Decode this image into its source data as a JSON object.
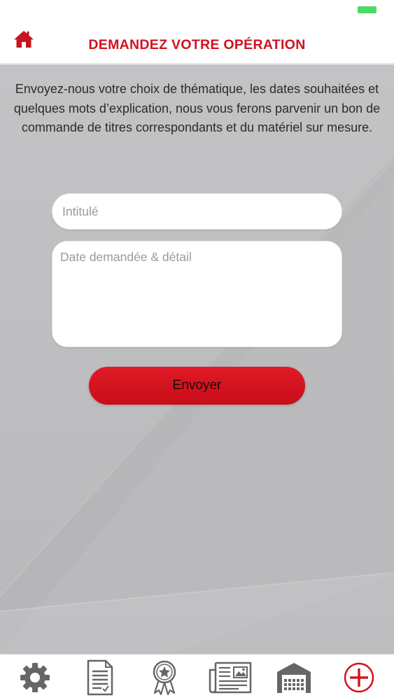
{
  "header": {
    "title": "DEMANDEZ VOTRE OPÉRATION",
    "home_icon": "home-icon"
  },
  "intro": {
    "text": "Envoyez-nous votre choix de thématique, les dates souhaitées et quelques mots d’explication, nous vous ferons parvenir un bon de commande de titres correspondants et du matériel sur mesure."
  },
  "form": {
    "title_placeholder": "Intitulé",
    "title_value": "",
    "detail_placeholder": "Date demandée & détail",
    "detail_value": "",
    "send_label": "Envoyer"
  },
  "tabbar": {
    "items": [
      {
        "icon": "gear-icon"
      },
      {
        "icon": "document-icon"
      },
      {
        "icon": "award-ribbon-icon"
      },
      {
        "icon": "newspaper-icon"
      },
      {
        "icon": "warehouse-icon"
      },
      {
        "icon": "plus-circle-icon",
        "active": true
      }
    ]
  },
  "colors": {
    "accent": "#d0121e",
    "background": "#bebec0",
    "battery": "#4cd964",
    "icon_gray": "#6a6a6a"
  }
}
